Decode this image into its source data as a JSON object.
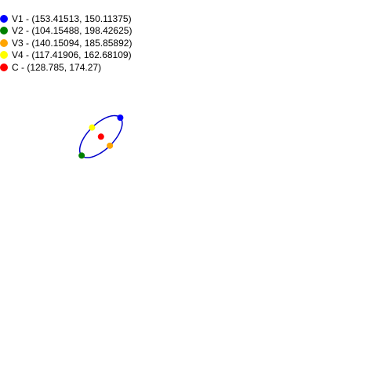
{
  "legend": [
    {
      "label": "V1 - (153.41513, 150.11375)",
      "color": "#0000ff",
      "x": 153.41513,
      "y": 150.11375
    },
    {
      "label": "V2 - (104.15488, 198.42625)",
      "color": "#008000",
      "x": 104.15488,
      "y": 198.42625
    },
    {
      "label": "V3 - (140.15094, 185.85892)",
      "color": "#ffa500",
      "x": 140.15094,
      "y": 185.85892
    },
    {
      "label": "V4 - (117.41906, 162.68109)",
      "color": "#ffff00",
      "x": 117.41906,
      "y": 162.68109
    },
    {
      "label": "C - (128.785, 174.27)",
      "color": "#ff0000",
      "x": 128.785,
      "y": 174.27
    }
  ],
  "ellipse": {
    "stroke_color": "#0000cc"
  }
}
